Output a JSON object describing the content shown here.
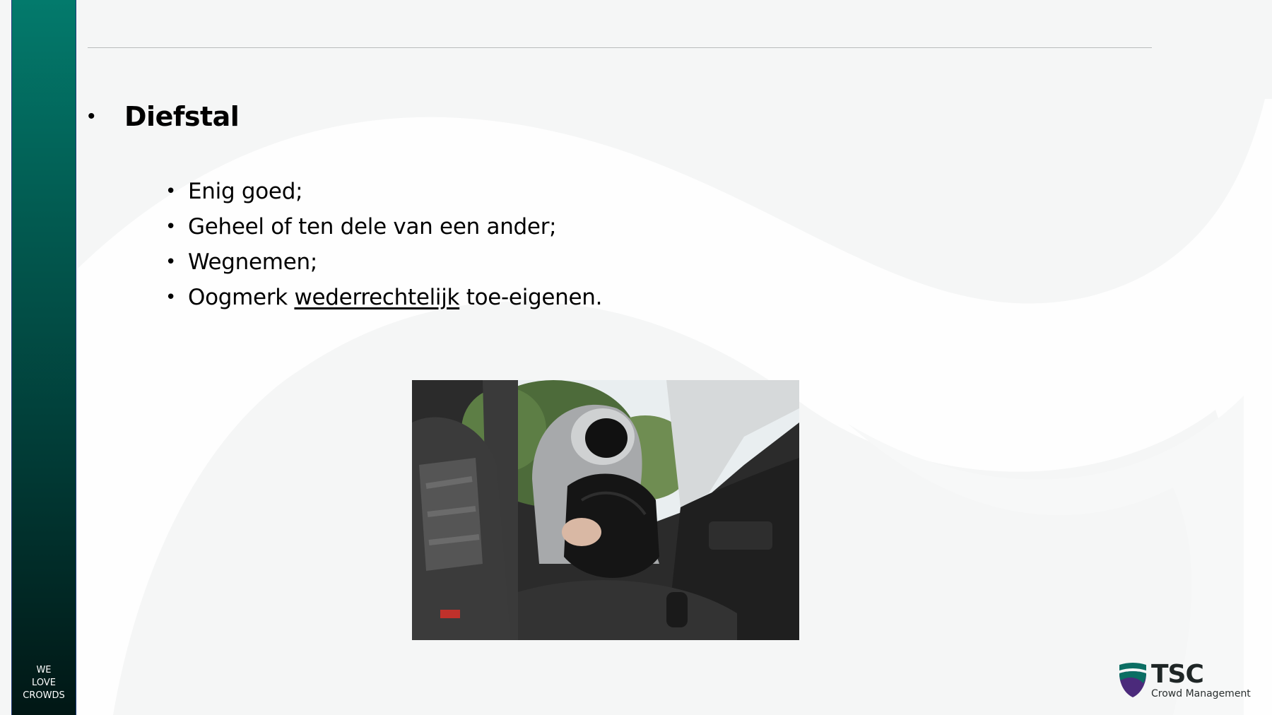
{
  "sidebar": {
    "tagline": [
      "WE",
      "LOVE",
      "CROWDS"
    ],
    "gradient_top": "#037a6c",
    "gradient_bottom": "#011715"
  },
  "slide": {
    "heading": "Diefstal",
    "bullets": [
      {
        "before": "Enig goed;",
        "underlined": "",
        "after": ""
      },
      {
        "before": "Geheel of ten dele van een ander;",
        "underlined": "",
        "after": ""
      },
      {
        "before": "Wegnemen;",
        "underlined": "",
        "after": ""
      },
      {
        "before": "Oogmerk ",
        "underlined": "wederrechtelijk",
        "after": " toe-eigenen."
      }
    ],
    "image_subject": "hooded-thief-taking-bag-from-car-photo"
  },
  "logo": {
    "name": "TSC",
    "subtitle": "Crowd Management",
    "colors": {
      "teal": "#0b6e63",
      "purple": "#4b2a7b"
    }
  }
}
